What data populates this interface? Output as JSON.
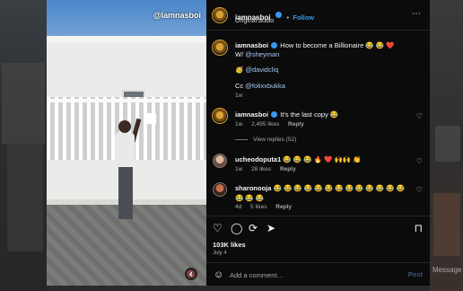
{
  "background": {
    "messages_label": "Message"
  },
  "media": {
    "watermark": "@lamnasboi"
  },
  "post": {
    "username": "iamnasboi",
    "follow_label": "Follow",
    "separator": "•",
    "audio": "Original audio"
  },
  "caption": {
    "username": "iamnasboi",
    "text": "How to become a Billionaire 😂 😂 ❤️",
    "line2_prefix": "W/",
    "mention1": "@sheyman",
    "emoji_line": "🥳",
    "mention2": "@davidcliq",
    "cc_prefix": "Cc",
    "mention3": "@folixxbukka",
    "time": "1w"
  },
  "comments": [
    {
      "username": "iamnasboi",
      "text": "It's the last copy 😂",
      "time": "1w",
      "likes": "2,495 likes",
      "reply": "Reply",
      "view_replies": "View replies (52)"
    },
    {
      "username": "ucheodoputa1",
      "text": "😂 😂 😂 🔥 ❤️ 🙌🙌 👏",
      "time": "1w",
      "likes": "28 likes",
      "reply": "Reply"
    },
    {
      "username": "sharonooja",
      "text": "😂 😂 😂 😂 😂 😂 😂 😂 😂 😂 😂 😂 😂 😂 😂 😂",
      "time": "4d",
      "likes": "5 likes",
      "reply": "Reply"
    }
  ],
  "footer": {
    "likes": "103K likes",
    "date": "July 4",
    "comment_placeholder": "Add a comment…",
    "post_label": "Post"
  },
  "icons": {
    "more": "⋯",
    "heart": "♡",
    "comment": "◯",
    "repost": "⟳",
    "share": "➤",
    "save": "⊓",
    "emoji": "☺",
    "mute": "🔇"
  },
  "colors": {
    "accent": "#3797f0",
    "panel_bg": "#0b0b0b",
    "link": "#a5c7f5"
  }
}
